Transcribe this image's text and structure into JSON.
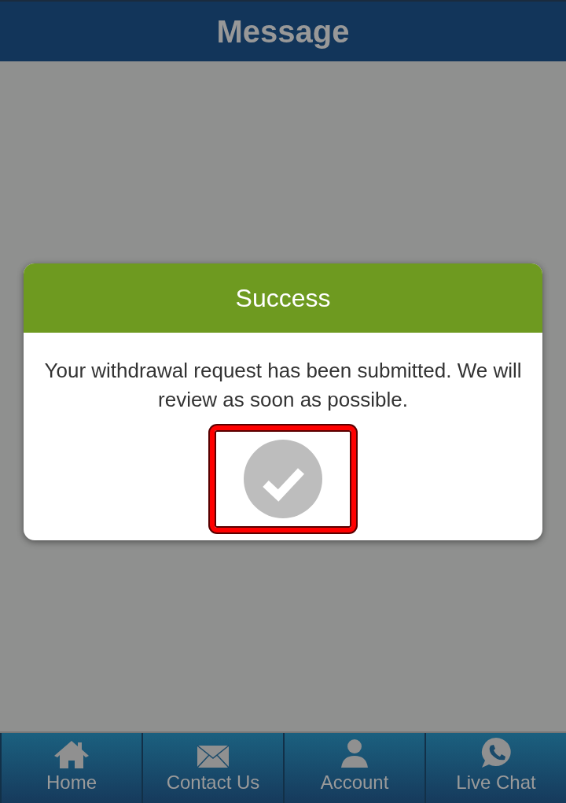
{
  "header": {
    "title": "Message"
  },
  "dialog": {
    "title": "Success",
    "message": "Your withdrawal request has been submitted. We will review as soon as possible.",
    "confirm_button": {
      "highlighted": true
    }
  },
  "nav": [
    {
      "label": "Home",
      "selected": false
    },
    {
      "label": "Contact Us",
      "selected": false
    },
    {
      "label": "Account",
      "selected": false
    },
    {
      "label": "Live Chat",
      "selected": false
    }
  ]
}
